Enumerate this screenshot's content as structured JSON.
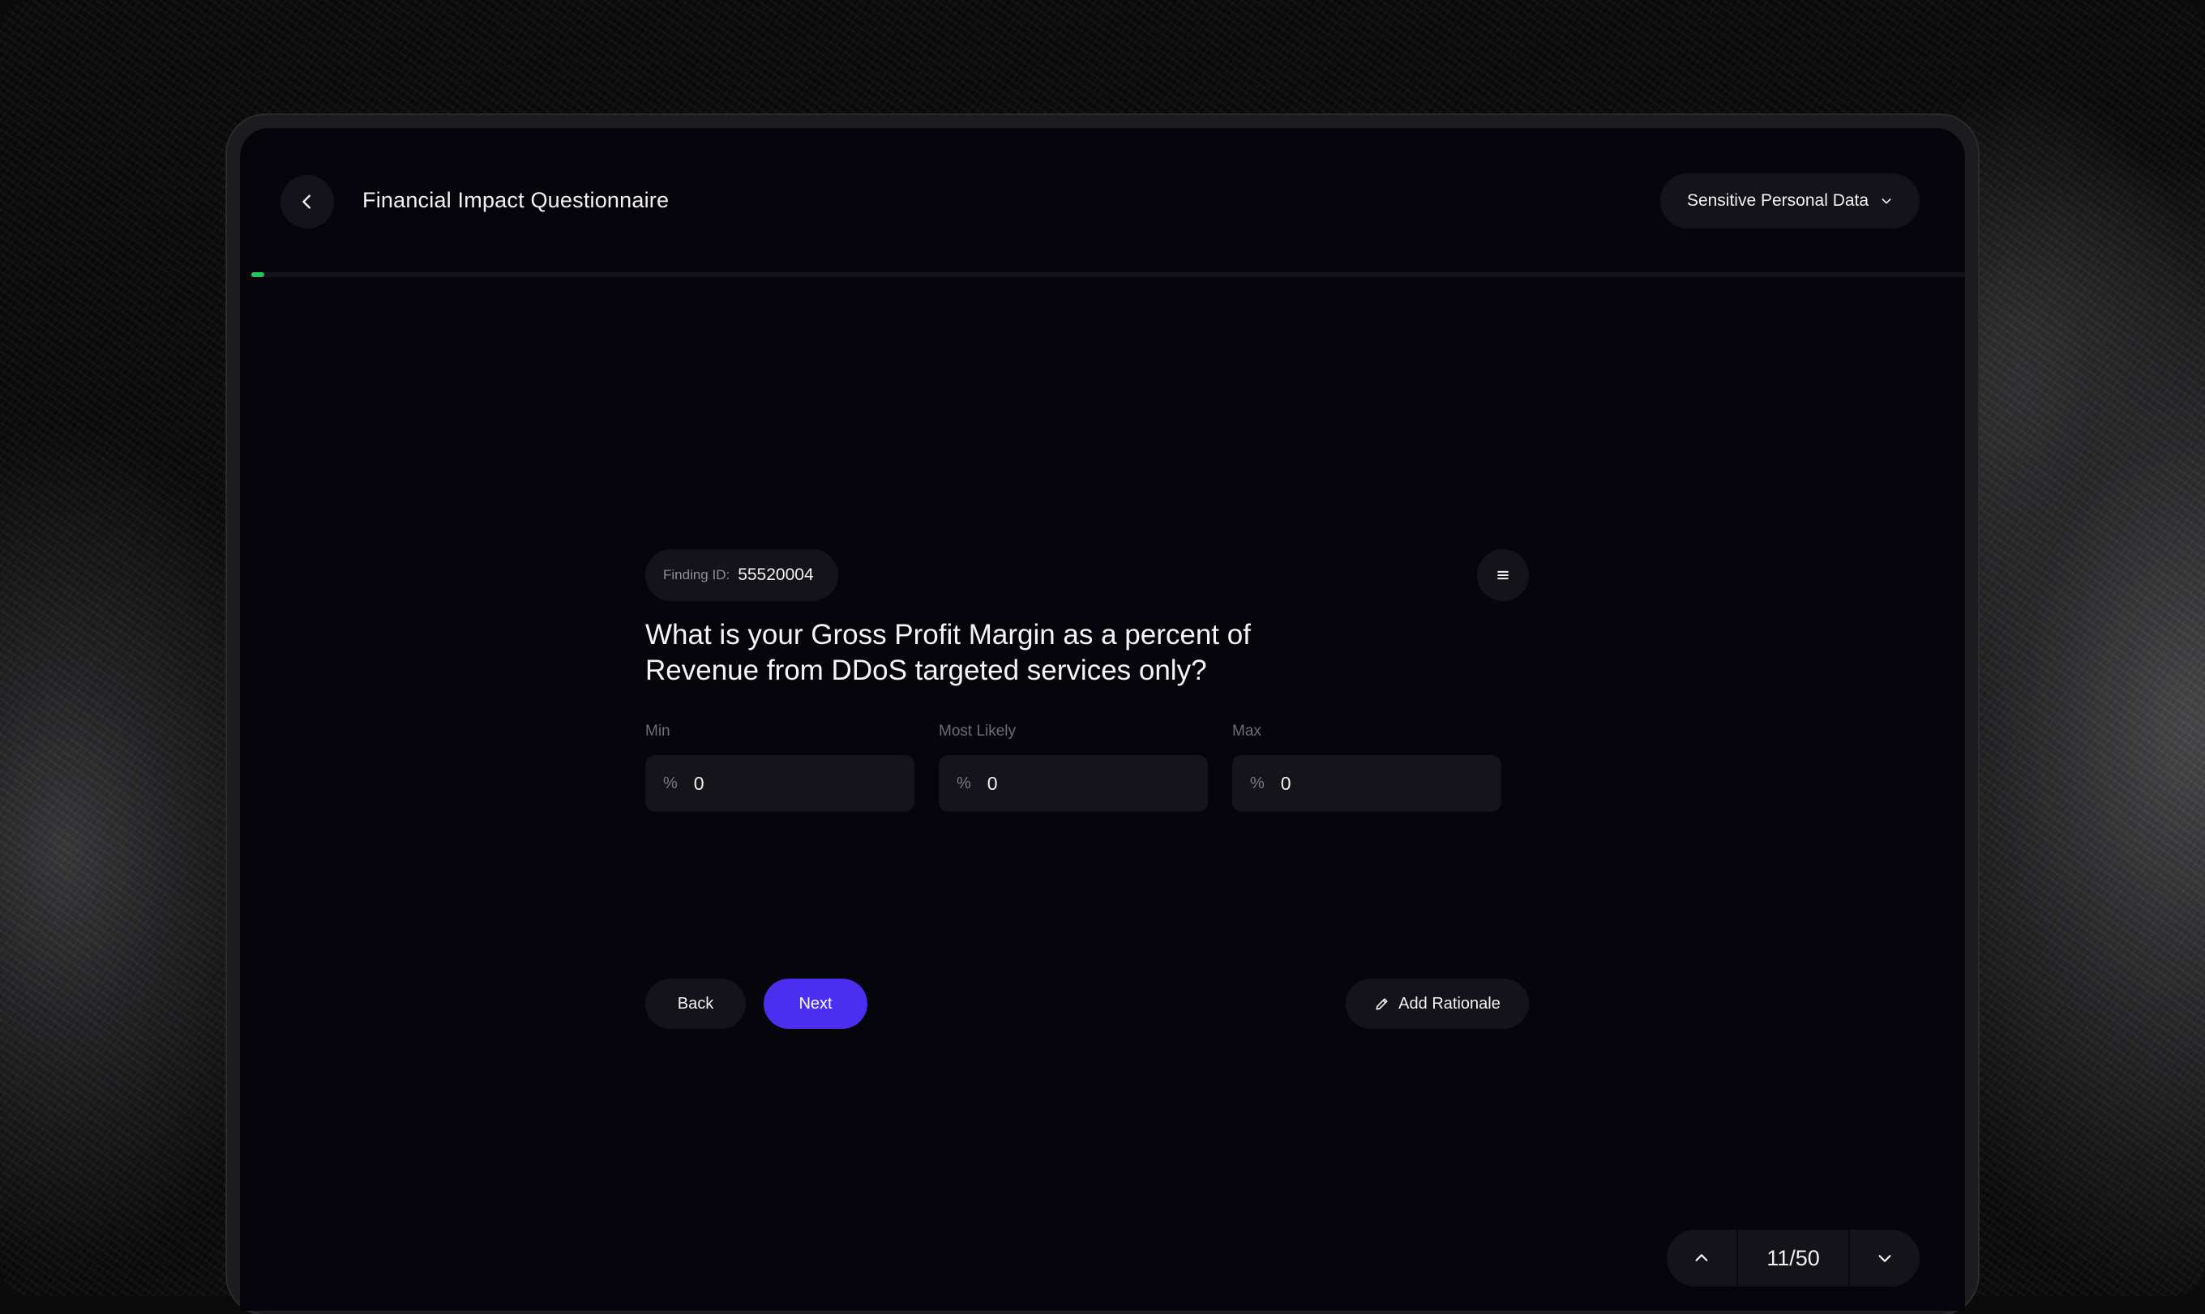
{
  "header": {
    "title": "Financial Impact Questionnaire",
    "category": "Sensitive Personal Data"
  },
  "progress": {
    "current": 11,
    "total": 50,
    "fraction": 0.01,
    "color": "#22c55e"
  },
  "finding": {
    "label": "Finding ID:",
    "value": "55520004"
  },
  "question": "What is your Gross Profit Margin as a percent of Revenue from DDoS targeted services only?",
  "fields": [
    {
      "label": "Min",
      "unit": "%",
      "value": "0"
    },
    {
      "label": "Most Likely",
      "unit": "%",
      "value": "0"
    },
    {
      "label": "Max",
      "unit": "%",
      "value": "0"
    }
  ],
  "actions": {
    "back_label": "Back",
    "next_label": "Next",
    "rationale_label": "Add Rationale"
  },
  "pager": {
    "label": "11/50"
  },
  "colors": {
    "accent": "#4a2ff0",
    "progress": "#22c55e",
    "background": "#06050b"
  },
  "icons": [
    "chevron-left-icon",
    "chevron-down-icon",
    "menu-icon",
    "pencil-icon",
    "chevron-up-icon"
  ]
}
